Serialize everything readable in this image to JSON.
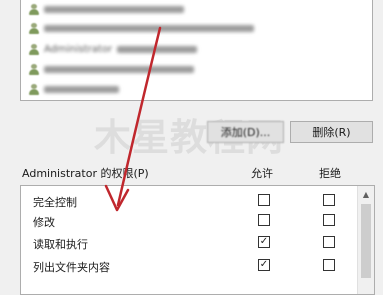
{
  "users_list": {
    "entries": [
      {
        "name": "Administrator"
      },
      {
        "name": ""
      },
      {
        "name": ""
      },
      {
        "name": ""
      },
      {
        "name": ""
      }
    ]
  },
  "buttons": {
    "add_label": "添加(D)...",
    "remove_label": "删除(R)"
  },
  "watermark": "木星教程网",
  "permissions": {
    "title": "Administrator 的权限(P)",
    "allow_header": "允许",
    "deny_header": "拒绝",
    "rows": [
      {
        "label": "完全控制",
        "allow": false,
        "deny": false
      },
      {
        "label": "修改",
        "allow": false,
        "deny": false
      },
      {
        "label": "读取和执行",
        "allow": true,
        "deny": false
      },
      {
        "label": "列出文件夹内容",
        "allow": true,
        "deny": false
      }
    ]
  },
  "colors": {
    "annotation_arrow": "#c0272d",
    "window_bg": "#f0f0f0"
  }
}
